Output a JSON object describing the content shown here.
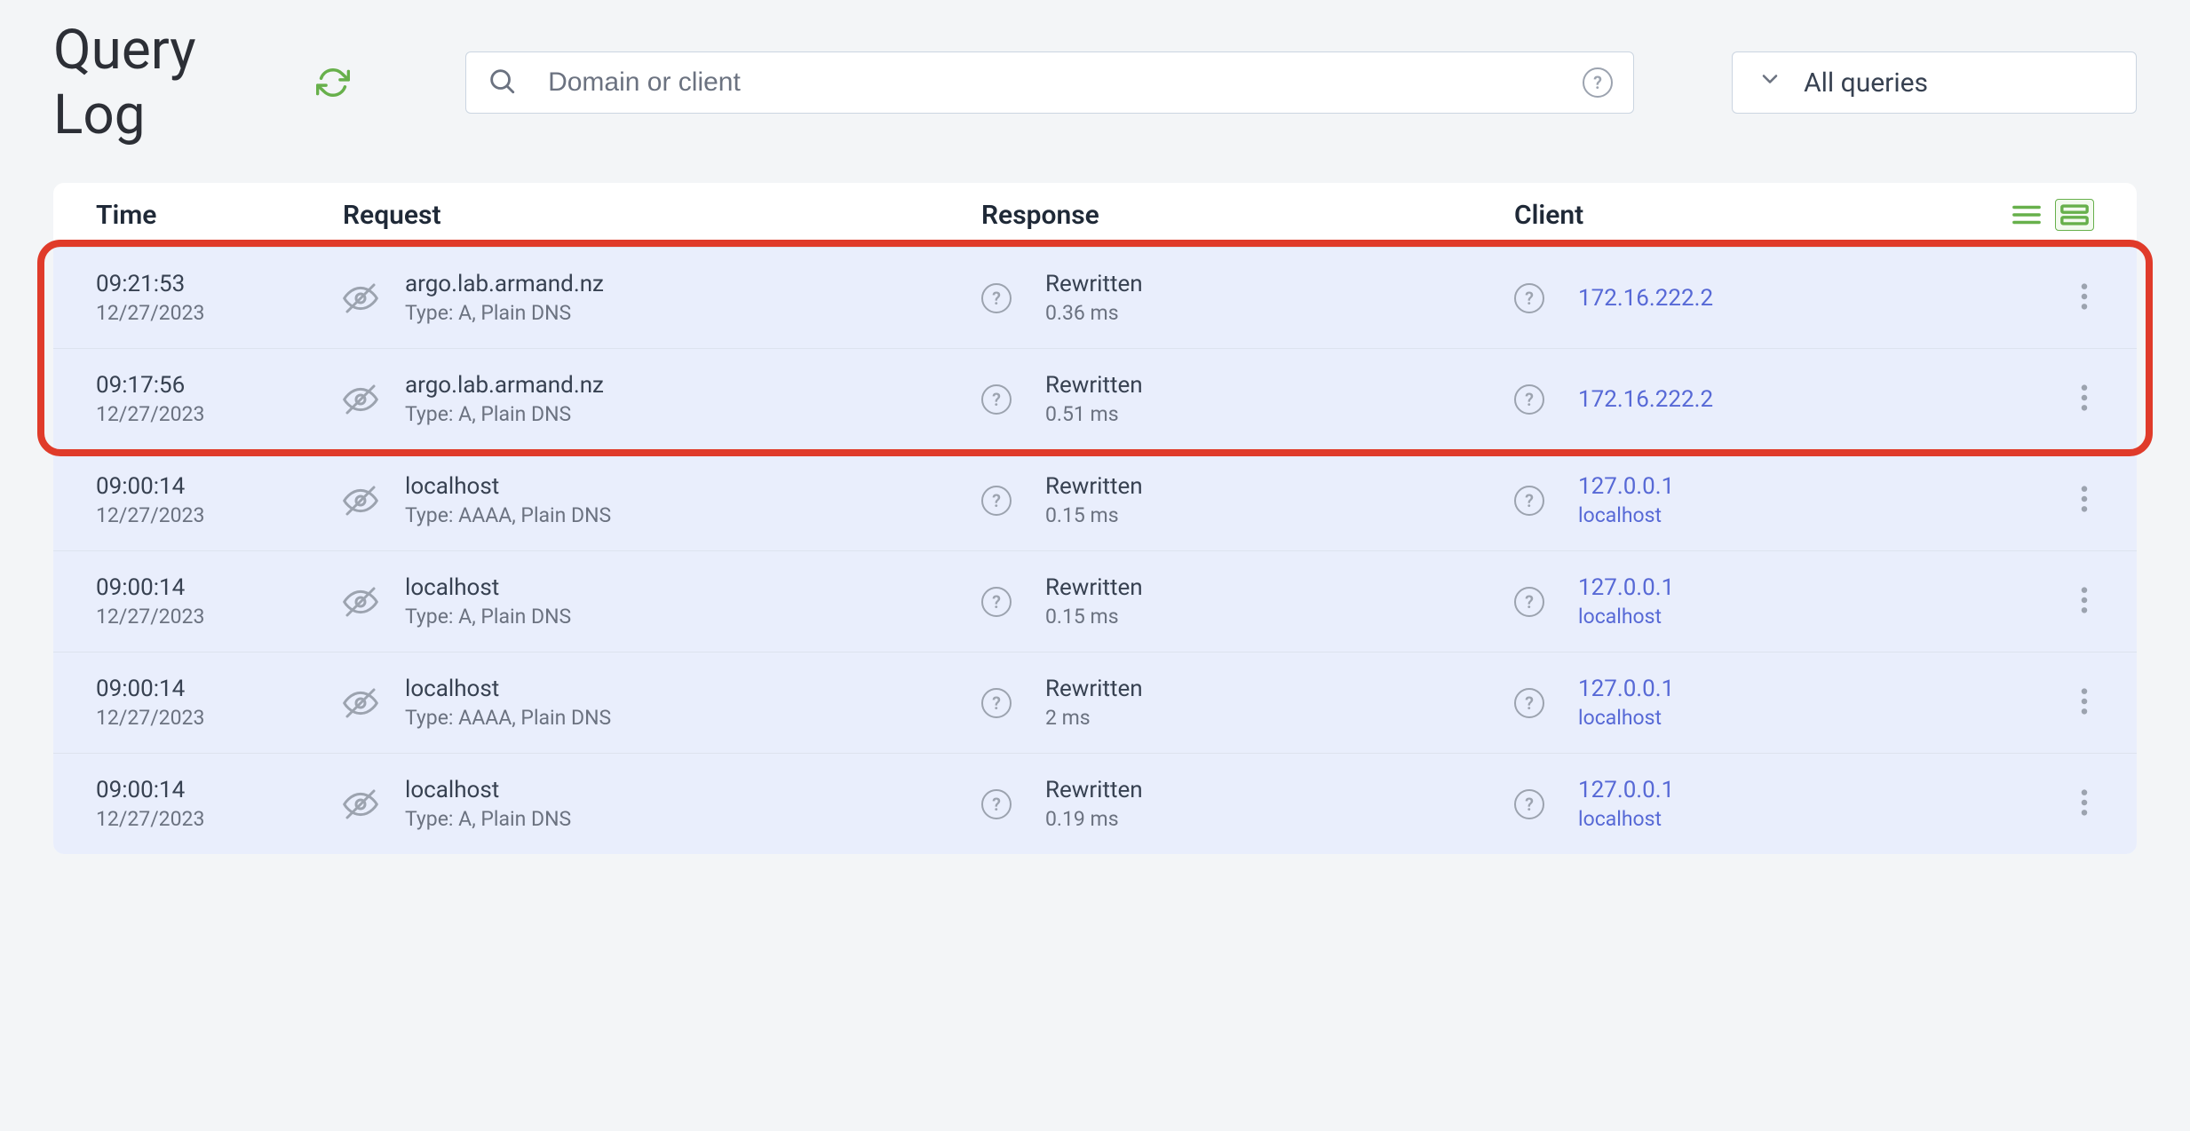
{
  "page_title": "Query Log",
  "search": {
    "placeholder": "Domain or client"
  },
  "filter_label": "All queries",
  "columns": {
    "time": "Time",
    "request": "Request",
    "response": "Response",
    "client": "Client"
  },
  "rows": [
    {
      "time": "09:21:53",
      "date": "12/27/2023",
      "domain": "argo.lab.armand.nz",
      "type": "Type: A, Plain DNS",
      "response": "Rewritten",
      "latency": "0.36 ms",
      "client_ip": "172.16.222.2",
      "client_name": ""
    },
    {
      "time": "09:17:56",
      "date": "12/27/2023",
      "domain": "argo.lab.armand.nz",
      "type": "Type: A, Plain DNS",
      "response": "Rewritten",
      "latency": "0.51 ms",
      "client_ip": "172.16.222.2",
      "client_name": ""
    },
    {
      "time": "09:00:14",
      "date": "12/27/2023",
      "domain": "localhost",
      "type": "Type: AAAA, Plain DNS",
      "response": "Rewritten",
      "latency": "0.15 ms",
      "client_ip": "127.0.0.1",
      "client_name": "localhost"
    },
    {
      "time": "09:00:14",
      "date": "12/27/2023",
      "domain": "localhost",
      "type": "Type: A, Plain DNS",
      "response": "Rewritten",
      "latency": "0.15 ms",
      "client_ip": "127.0.0.1",
      "client_name": "localhost"
    },
    {
      "time": "09:00:14",
      "date": "12/27/2023",
      "domain": "localhost",
      "type": "Type: AAAA, Plain DNS",
      "response": "Rewritten",
      "latency": "2 ms",
      "client_ip": "127.0.0.1",
      "client_name": "localhost"
    },
    {
      "time": "09:00:14",
      "date": "12/27/2023",
      "domain": "localhost",
      "type": "Type: A, Plain DNS",
      "response": "Rewritten",
      "latency": "0.19 ms",
      "client_ip": "127.0.0.1",
      "client_name": "localhost"
    }
  ]
}
